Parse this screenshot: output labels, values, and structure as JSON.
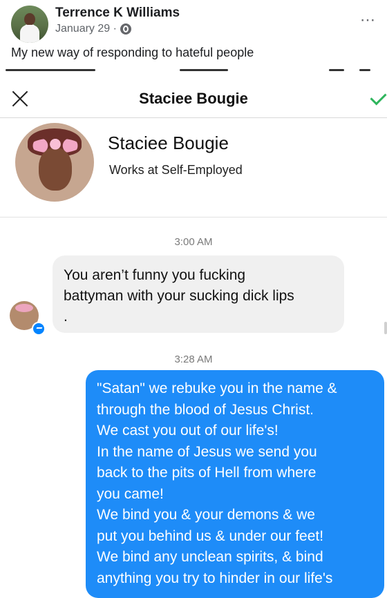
{
  "post": {
    "author": "Terrence K Williams",
    "date": "January 29 ·",
    "text": "My new way of responding to hateful people",
    "more_icon": "⋯"
  },
  "chat": {
    "title": "Staciee Bougie",
    "profile": {
      "name": "Staciee Bougie",
      "work": "Works at Self-Employed"
    },
    "time1": "3:00 AM",
    "incoming": "You aren’t funny you fucking\nbattyman with your sucking dick lips\n.",
    "time2": "3:28 AM",
    "outgoing": "\"Satan\" we rebuke you in the name &\nthrough the blood of Jesus Christ.\nWe cast you out of our life's!\n In the name of Jesus we send you\nback to the pits of Hell from where\nyou came!\nWe bind you & your demons & we\nput you behind us & under our feet!\nWe bind any unclean spirits, & bind\nanything you try to hinder in our life's"
  },
  "colors": {
    "outgoing_bubble": "#1e8cf8",
    "incoming_bubble": "#f0f0f0",
    "check": "#2eb55c"
  },
  "icons": [
    "globe-icon",
    "more-icon",
    "close-icon",
    "check-icon",
    "messenger-icon"
  ]
}
